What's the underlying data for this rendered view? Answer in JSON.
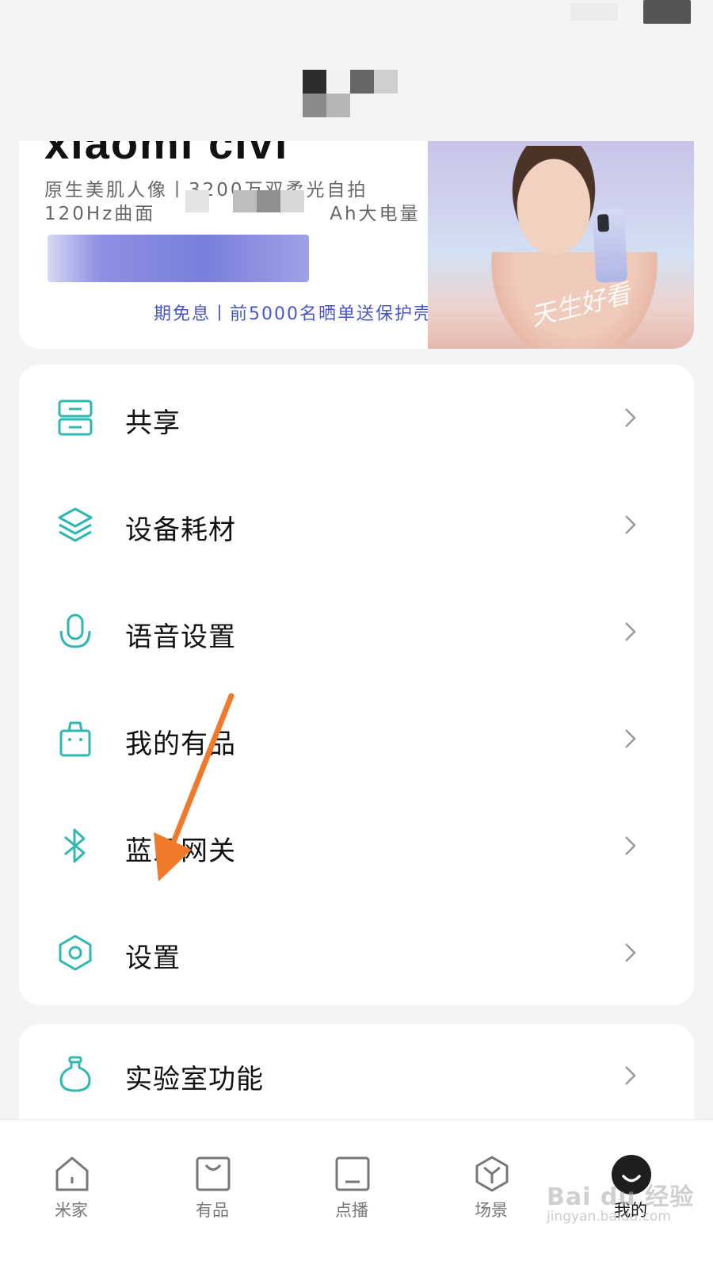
{
  "banner": {
    "brand": "xiaomi civi",
    "line1": "原生美肌人像丨3200万双柔光自拍",
    "line2_part1": "120Hz曲面",
    "line2_part2": "Ah大电量",
    "promo": "期免息丨前5000名晒单送保护壳",
    "photo_sign": "天生好看"
  },
  "menu": {
    "items": [
      {
        "label": "共享",
        "icon": "server-icon"
      },
      {
        "label": "设备耗材",
        "icon": "layers-icon"
      },
      {
        "label": "语音设置",
        "icon": "microphone-icon"
      },
      {
        "label": "我的有品",
        "icon": "shopping-bag-icon"
      },
      {
        "label": "蓝牙网关",
        "icon": "bluetooth-icon"
      },
      {
        "label": "设置",
        "icon": "hexagon-settings-icon"
      }
    ],
    "lab": {
      "label": "实验室功能",
      "icon": "flask-icon"
    }
  },
  "bottom_nav": {
    "items": [
      {
        "label": "米家",
        "icon": "home-icon"
      },
      {
        "label": "有品",
        "icon": "bag-icon"
      },
      {
        "label": "点播",
        "icon": "screen-icon"
      },
      {
        "label": "场景",
        "icon": "cube-icon"
      },
      {
        "label": "我的",
        "icon": "profile-avatar-icon",
        "active": true
      }
    ]
  },
  "watermark": {
    "text": "Bai du 经验",
    "url": "jingyan.baidu.com"
  },
  "colors": {
    "accent_icon": "#2fb8b0",
    "annotation_arrow": "#f07a2a",
    "promo_text": "#4a56c8"
  }
}
